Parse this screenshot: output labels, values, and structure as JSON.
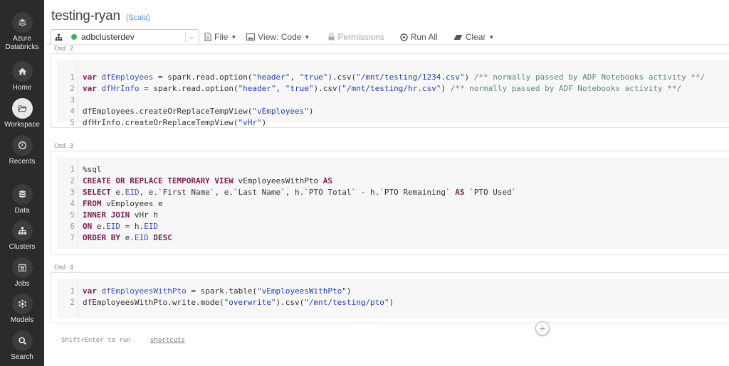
{
  "sidebar": {
    "items": [
      {
        "label": "Azure\nDatabricks",
        "icon": "layers-icon"
      },
      {
        "label": "Home",
        "icon": "home-icon"
      },
      {
        "label": "Workspace",
        "icon": "folder-icon",
        "active": true
      },
      {
        "label": "Recents",
        "icon": "clock-icon"
      },
      {
        "label": "Data",
        "icon": "database-icon"
      },
      {
        "label": "Clusters",
        "icon": "sitemap-icon"
      },
      {
        "label": "Jobs",
        "icon": "calendar-icon"
      },
      {
        "label": "Models",
        "icon": "network-icon"
      },
      {
        "label": "Search",
        "icon": "search-icon"
      }
    ]
  },
  "notebook": {
    "title": "testing-ryan",
    "language": "(Scala)"
  },
  "toolbar": {
    "cluster_name": "adbclusterdev",
    "cluster_status_color": "#3fb34f",
    "file_label": "File",
    "view_label": "View: Code",
    "permissions_label": "Permissions",
    "run_all_label": "Run All",
    "clear_label": "Clear"
  },
  "cells": [
    {
      "label": "Cmd 2",
      "lines": [
        "1",
        "2",
        "3",
        "4",
        "5"
      ]
    },
    {
      "label": "Cmd 3",
      "lines": [
        "1",
        "2",
        "3",
        "4",
        "5",
        "6",
        "7"
      ]
    },
    {
      "label": "Cmd 4",
      "lines": [
        "1",
        "2"
      ]
    }
  ],
  "code": {
    "c2": {
      "l1": [
        "var",
        " dfEmployees",
        " = spark.read.option(",
        "\"header\"",
        ", ",
        "\"true\"",
        ").csv(",
        "\"/mnt/testing/1234.csv\"",
        ") ",
        "/** normally passed by ADF Notebooks activity **/"
      ],
      "l2": [
        "var",
        " dfHrInfo",
        " = spark.read.option(",
        "\"header\"",
        ", ",
        "\"true\"",
        ").csv(",
        "\"/mnt/testing/hr.csv\"",
        ") ",
        "/** normally passed by ADF Notebooks activity **/"
      ],
      "l4": [
        "dfEmployees.createOrReplaceTempView(",
        "\"vEmployees\"",
        ")"
      ],
      "l5": [
        "dfHrInfo.createOrReplaceTempView(",
        "\"vHr\"",
        ")"
      ]
    },
    "c3": {
      "l1": "%sql",
      "l2": [
        "CREATE OR REPLACE TEMPORARY VIEW",
        " vEmployeesWithPto ",
        "AS"
      ],
      "l3": [
        "SELECT",
        " e.",
        "EID",
        ", e.`First Name`, e.`Last Name`, h.`PTO Total` - h.`PTO Remaining` ",
        "AS",
        " `PTO Used`"
      ],
      "l4": [
        "FROM",
        " vEmployees e"
      ],
      "l5": [
        "INNER JOIN",
        " vHr h"
      ],
      "l6": [
        "ON",
        " e.",
        "EID",
        " = h.",
        "EID"
      ],
      "l7": [
        "ORDER BY",
        " e.",
        "EID",
        " ",
        "DESC"
      ]
    },
    "c4": {
      "l1": [
        "var",
        " dfEmployeesWithPto",
        " = spark.table(",
        "\"vEmployeesWithPto\"",
        ")"
      ],
      "l2": [
        "dfEmployeesWithPto.write.mode(",
        "\"overwrite\"",
        ").csv(",
        "\"/mnt/testing/pto\"",
        ")"
      ]
    }
  },
  "footer": {
    "hint": "Shift+Enter to run",
    "shortcuts_label": "shortcuts",
    "add_cell_symbol": "+"
  }
}
